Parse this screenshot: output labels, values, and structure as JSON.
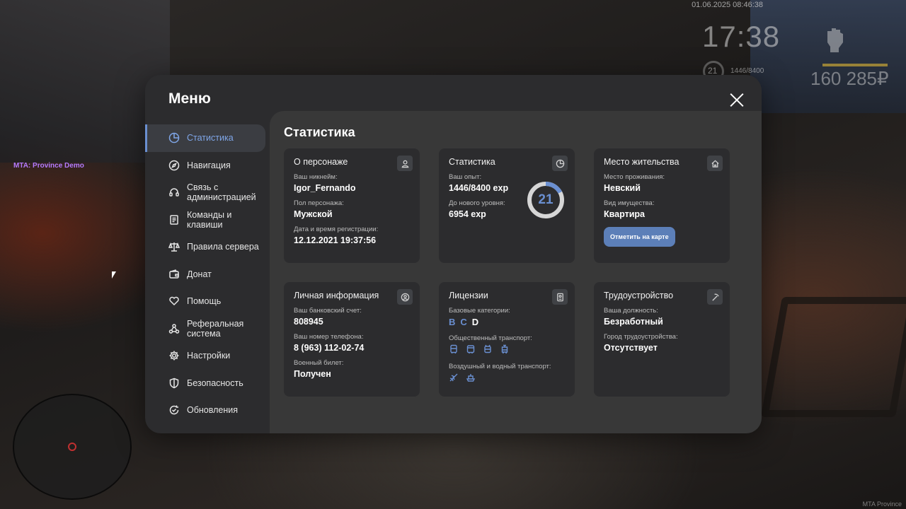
{
  "hud": {
    "datetime": "01.06.2025 08:46:38",
    "time": "17:38",
    "level": "21",
    "exp": "1446/8400",
    "money": "160 285₽",
    "server_tag": "MTA: Province Demo",
    "footer_tag": "MTA Province"
  },
  "menu": {
    "title": "Меню",
    "sidebar": [
      {
        "label": "Статистика",
        "icon": "pie-chart-icon"
      },
      {
        "label": "Навигация",
        "icon": "compass-icon"
      },
      {
        "label": "Связь с администрацией",
        "icon": "headset-icon"
      },
      {
        "label": "Команды и клавиши",
        "icon": "document-icon"
      },
      {
        "label": "Правила сервера",
        "icon": "scales-icon"
      },
      {
        "label": "Донат",
        "icon": "wallet-icon"
      },
      {
        "label": "Помощь",
        "icon": "heart-hand-icon"
      },
      {
        "label": "Реферальная система",
        "icon": "network-icon"
      },
      {
        "label": "Настройки",
        "icon": "gear-icon"
      },
      {
        "label": "Безопасность",
        "icon": "shield-icon"
      },
      {
        "label": "Обновления",
        "icon": "refresh-check-icon"
      }
    ]
  },
  "content": {
    "title": "Статистика",
    "character": {
      "title": "О персонаже",
      "nickname_label": "Ваш никнейм:",
      "nickname": "Igor_Fernando",
      "gender_label": "Пол персонажа:",
      "gender": "Мужской",
      "reg_label": "Дата и время регистрации:",
      "reg": "12.12.2021 19:37:56"
    },
    "stats": {
      "title": "Статистика",
      "exp_label": "Ваш опыт:",
      "exp": "1446/8400 exp",
      "next_label": "До нового уровня:",
      "next": "6954 exp",
      "level": "21",
      "progress": 0.172
    },
    "residence": {
      "title": "Место жительства",
      "place_label": "Место проживания:",
      "place": "Невский",
      "type_label": "Вид имущества:",
      "type": "Квартира",
      "button": "Отметить на карте"
    },
    "personal": {
      "title": "Личная информация",
      "bank_label": "Ваш банковский счет:",
      "bank": "808945",
      "phone_label": "Ваш номер телефона:",
      "phone": "8 (963) 112-02-74",
      "military_label": "Военный билет:",
      "military": "Получен"
    },
    "licenses": {
      "title": "Лицензии",
      "base_label": "Базовые категории:",
      "categories": [
        "B",
        "C",
        "D"
      ],
      "public_label": "Общественный транспорт:",
      "air_label": "Воздушный и водный транспорт:"
    },
    "job": {
      "title": "Трудоустройство",
      "position_label": "Ваша должность:",
      "position": "Безработный",
      "city_label": "Город трудоустройства:",
      "city": "Отсутствует"
    }
  },
  "colors": {
    "accent": "#6a8fd1",
    "button": "#5c7fb8",
    "panel": "#2c2c2e",
    "content_bg": "#383838"
  }
}
